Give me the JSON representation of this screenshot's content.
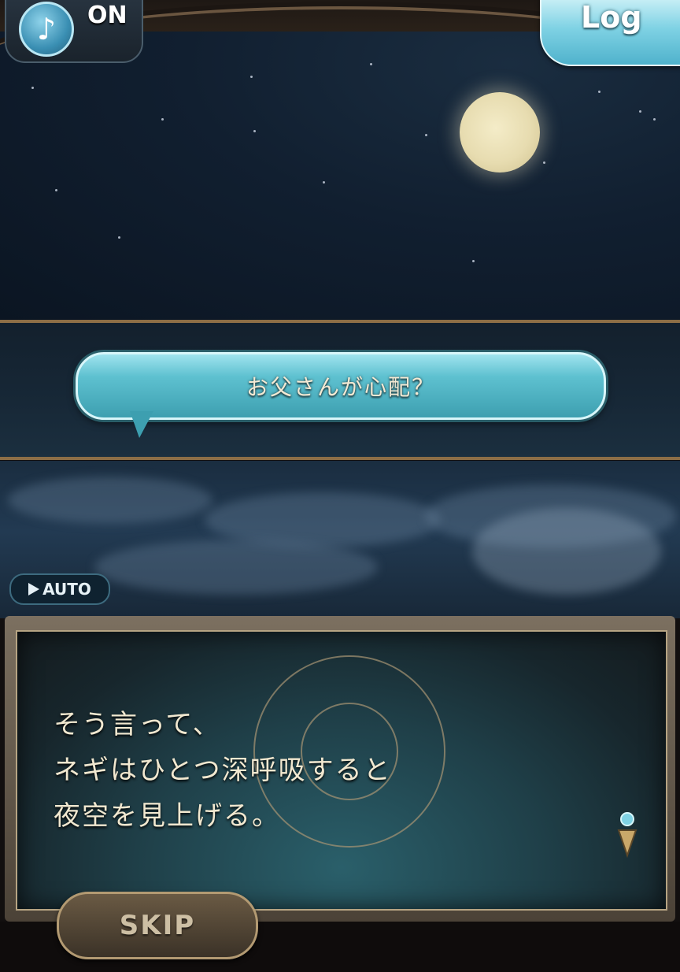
{
  "hud": {
    "music_icon": "music-note-icon",
    "music_state": "ON",
    "log_label": "Log"
  },
  "scene": {
    "speech_bubble_text": "お父さんが心配？"
  },
  "controls": {
    "auto_label": "AUTO",
    "auto_icon": "play-triangle-icon",
    "skip_label": "SKIP"
  },
  "dialogue": {
    "lines": [
      "そう言って、",
      "ネギはひとつ深呼吸すると",
      "夜空を見上げる。"
    ],
    "next_icon": "next-page-indicator-icon"
  },
  "colors": {
    "accent_cyan": "#5ec1d0",
    "frame_gold": "#8d6e46",
    "text_cream": "#f1e8d0"
  }
}
